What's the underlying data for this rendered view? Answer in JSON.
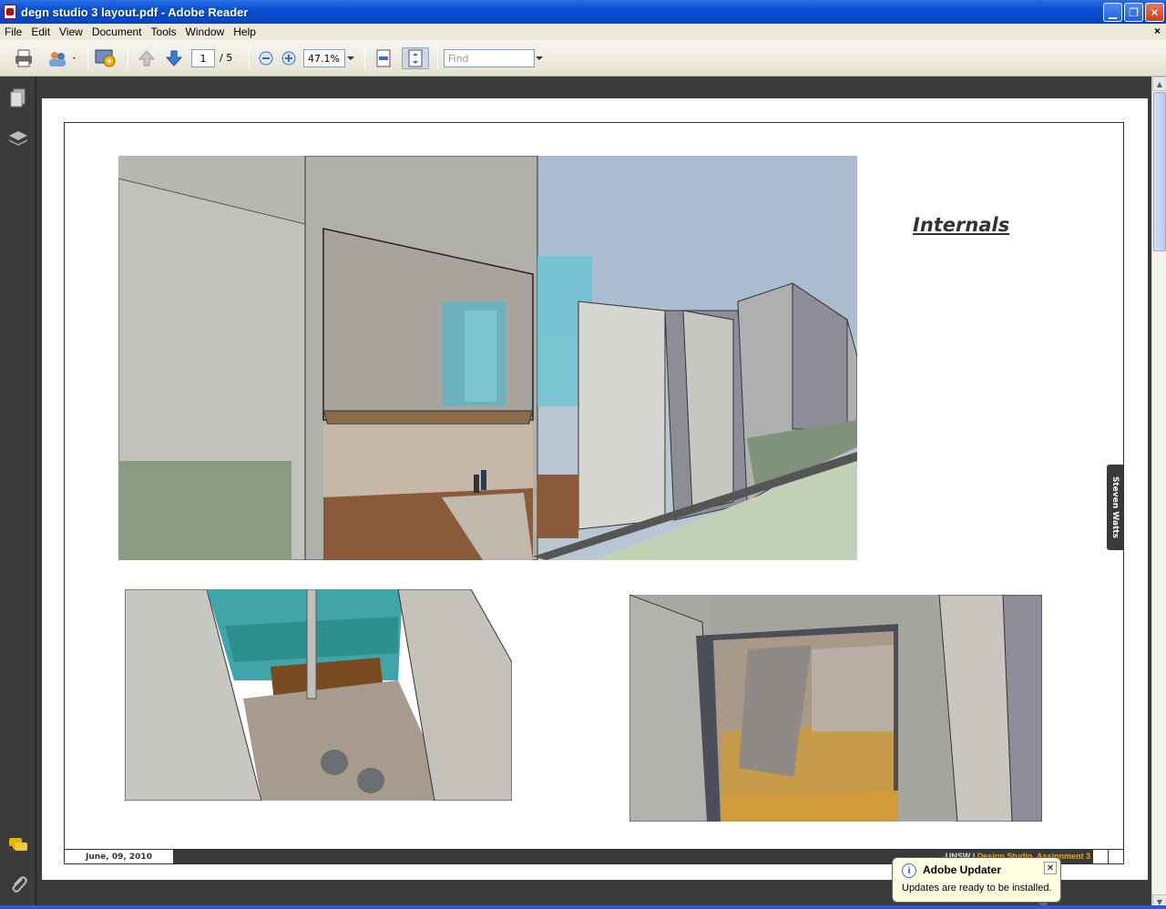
{
  "window": {
    "title": "degn studio 3 layout.pdf - Adobe Reader"
  },
  "menu": {
    "items": [
      "File",
      "Edit",
      "View",
      "Document",
      "Tools",
      "Window",
      "Help"
    ],
    "close": "×"
  },
  "toolbar": {
    "page_current": "1",
    "page_total": "/ 5",
    "zoom": "47.1%",
    "find_placeholder": "Find"
  },
  "document": {
    "heading": "Internals",
    "author": "Steven Watts",
    "footer_date": "June, 09, 2010",
    "footer_org": "UNSW | ",
    "footer_course": "Design Studio, Assignment 3"
  },
  "balloon": {
    "title": "Adobe Updater",
    "text": "Updates are ready to be installed."
  },
  "colors": {
    "titlebar": "#0a4fd0",
    "accent_orange": "#f2a200",
    "doc_bg": "#3b3b3b"
  }
}
